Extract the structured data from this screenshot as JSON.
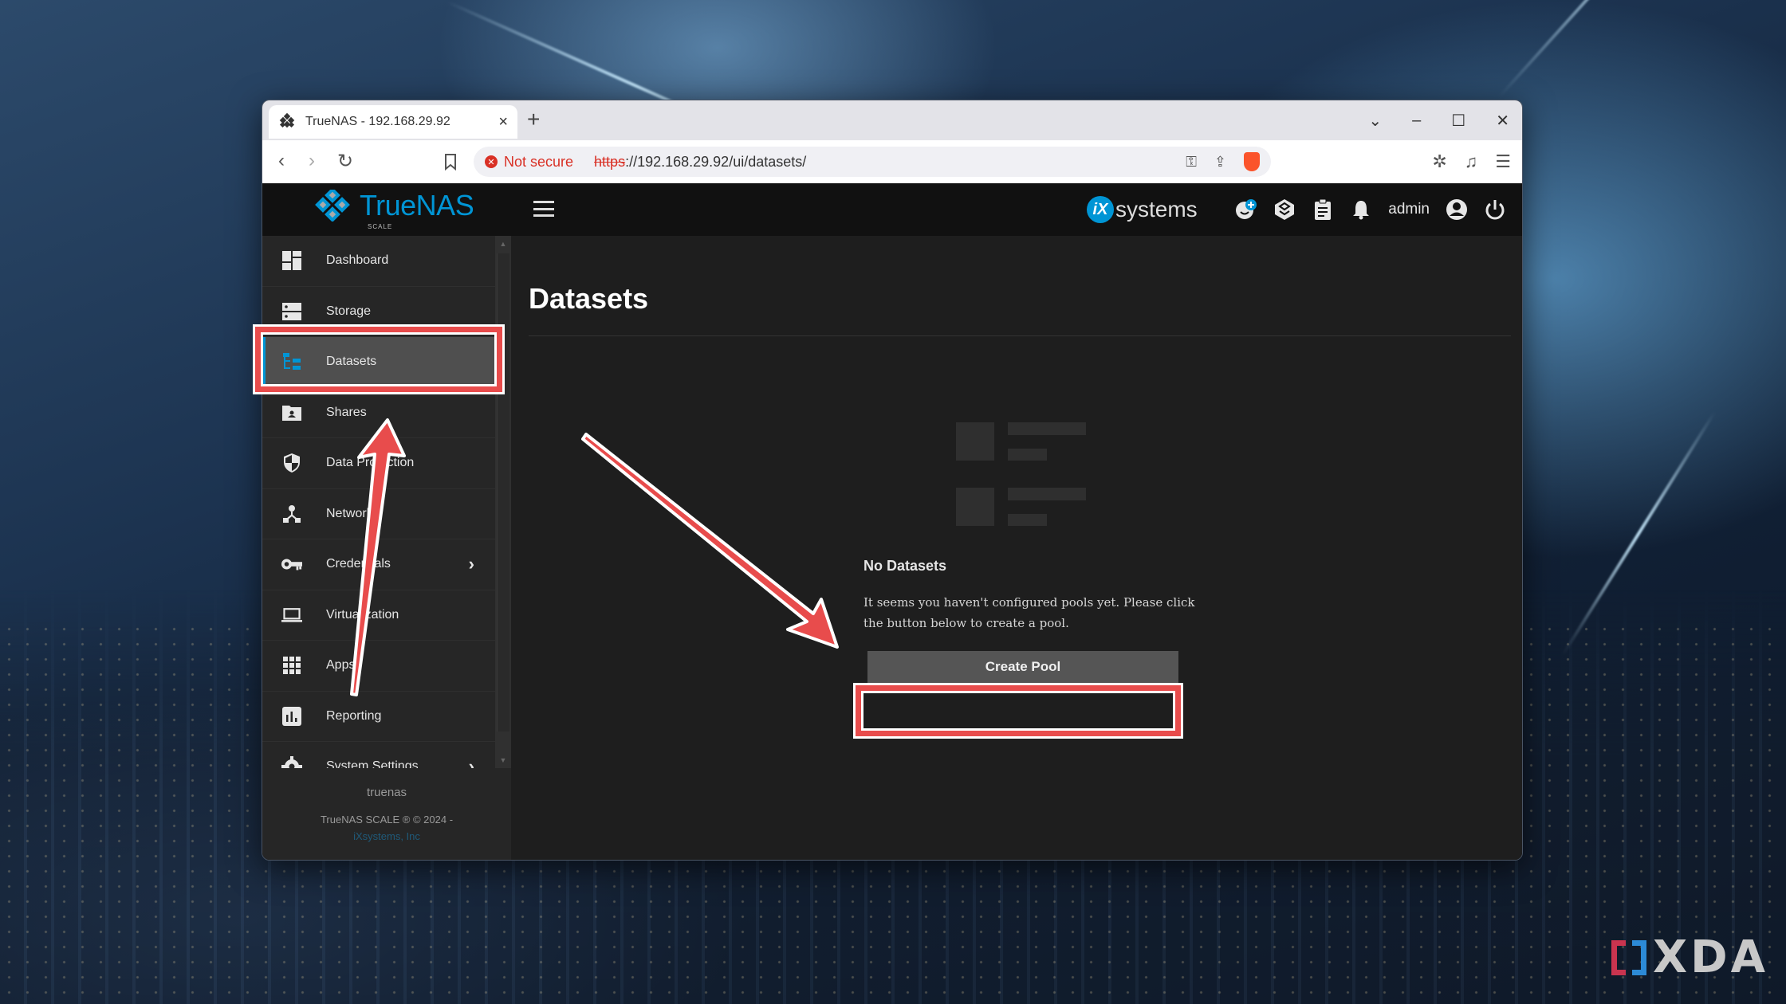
{
  "browser": {
    "tab_title": "TrueNAS - 192.168.29.92",
    "tab_close": "×",
    "new_tab": "+",
    "window_controls": {
      "tab_search": "⌄",
      "minimize": "–",
      "maximize": "☐",
      "close": "✕"
    },
    "nav": {
      "back": "‹",
      "forward": "›",
      "reload": "↻",
      "bookmark": "🔖"
    },
    "security_label": "Not secure",
    "url_scheme": "https",
    "url_rest": "://192.168.29.92/ui/datasets/",
    "omnibox_icons": [
      "key-icon",
      "share-icon",
      "brave-shields-icon"
    ],
    "toolbar_icons": [
      "extensions-icon",
      "media-icon",
      "menu-icon"
    ]
  },
  "app": {
    "brand": {
      "name": "TrueNAS",
      "edition": "SCALE",
      "brand_color": "#0095d5"
    },
    "vendor": {
      "logo_mark": "iX",
      "logo_text": "systems"
    },
    "topbar": {
      "icons": [
        "feedback-icon",
        "truecommand-icon",
        "jobs-clipboard-icon",
        "notifications-bell-icon"
      ],
      "username": "admin"
    },
    "sidebar": {
      "items": [
        {
          "label": "Dashboard",
          "icon": "dashboard-icon",
          "active": false,
          "has_submenu": false
        },
        {
          "label": "Storage",
          "icon": "storage-icon",
          "active": false,
          "has_submenu": false
        },
        {
          "label": "Datasets",
          "icon": "datasets-icon",
          "active": true,
          "has_submenu": false
        },
        {
          "label": "Shares",
          "icon": "shares-icon",
          "active": false,
          "has_submenu": false
        },
        {
          "label": "Data Protection",
          "icon": "shield-icon",
          "active": false,
          "has_submenu": false
        },
        {
          "label": "Network",
          "icon": "network-icon",
          "active": false,
          "has_submenu": false
        },
        {
          "label": "Credentials",
          "icon": "key-icon",
          "active": false,
          "has_submenu": true
        },
        {
          "label": "Virtualization",
          "icon": "laptop-icon",
          "active": false,
          "has_submenu": false
        },
        {
          "label": "Apps",
          "icon": "apps-grid-icon",
          "active": false,
          "has_submenu": false
        },
        {
          "label": "Reporting",
          "icon": "bar-chart-icon",
          "active": false,
          "has_submenu": false
        },
        {
          "label": "System Settings",
          "icon": "settings-gear-icon",
          "active": false,
          "has_submenu": true
        }
      ],
      "hostname": "truenas",
      "copyright": "TrueNAS SCALE ® © 2024 -",
      "vendor_link": "iXsystems, Inc"
    },
    "main": {
      "title": "Datasets",
      "empty_state": {
        "title": "No Datasets",
        "message": "It seems you haven't configured pools yet. Please click the button below to create a pool.",
        "button_label": "Create Pool"
      }
    }
  },
  "annotations": {
    "color": "#e84c4c",
    "highlighted": [
      "sidebar-item-datasets",
      "create-pool-button"
    ]
  },
  "watermark": {
    "text": "XDA"
  }
}
